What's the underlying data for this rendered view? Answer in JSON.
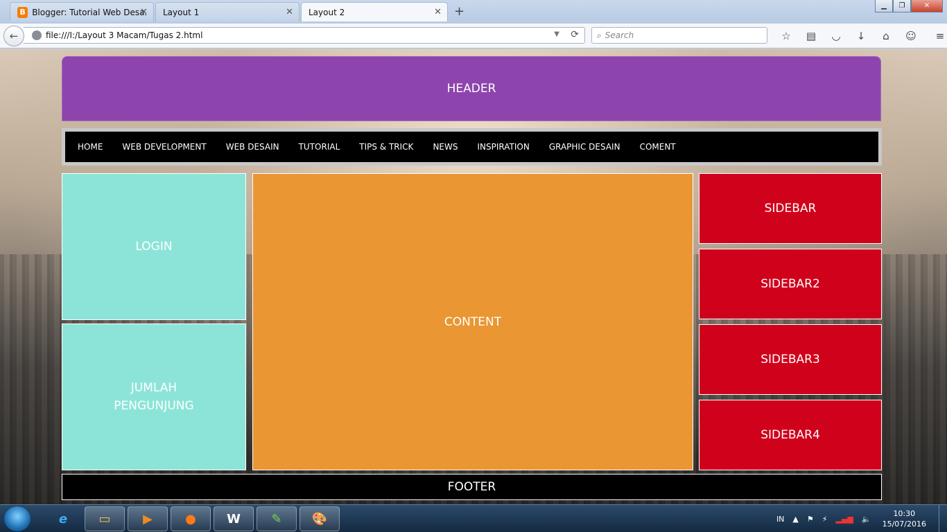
{
  "browser": {
    "tabs": [
      {
        "label": "Blogger: Tutorial Web Desa...",
        "active": false
      },
      {
        "label": "Layout 1",
        "active": false
      },
      {
        "label": "Layout 2",
        "active": true
      }
    ],
    "url": "file:///I:/Layout 3 Macam/Tugas 2.html",
    "search_placeholder": "Search"
  },
  "page": {
    "header": "HEADER",
    "menu": [
      "HOME",
      "WEB DEVELOPMENT",
      "WEB DESAIN",
      "TUTORIAL",
      "TIPS & TRICK",
      "NEWS",
      "INSPIRATION",
      "GRAPHIC DESAIN",
      "COMENT"
    ],
    "login": "LOGIN",
    "jumlah_line1": "JUMLAH",
    "jumlah_line2": "PENGUNJUNG",
    "content": "CONTENT",
    "sidebars": [
      "SIDEBAR",
      "SIDEBAR2",
      "SIDEBAR3",
      "SIDEBAR4"
    ],
    "footer": "FOOTER"
  },
  "colors": {
    "header": "#8e44ad",
    "menu": "#000000",
    "login": "#8ce4d8",
    "content": "#ea9632",
    "sidebar": "#d0021b",
    "footer": "#000000"
  },
  "taskbar": {
    "language": "IN",
    "time": "10:30",
    "date": "15/07/2016"
  }
}
